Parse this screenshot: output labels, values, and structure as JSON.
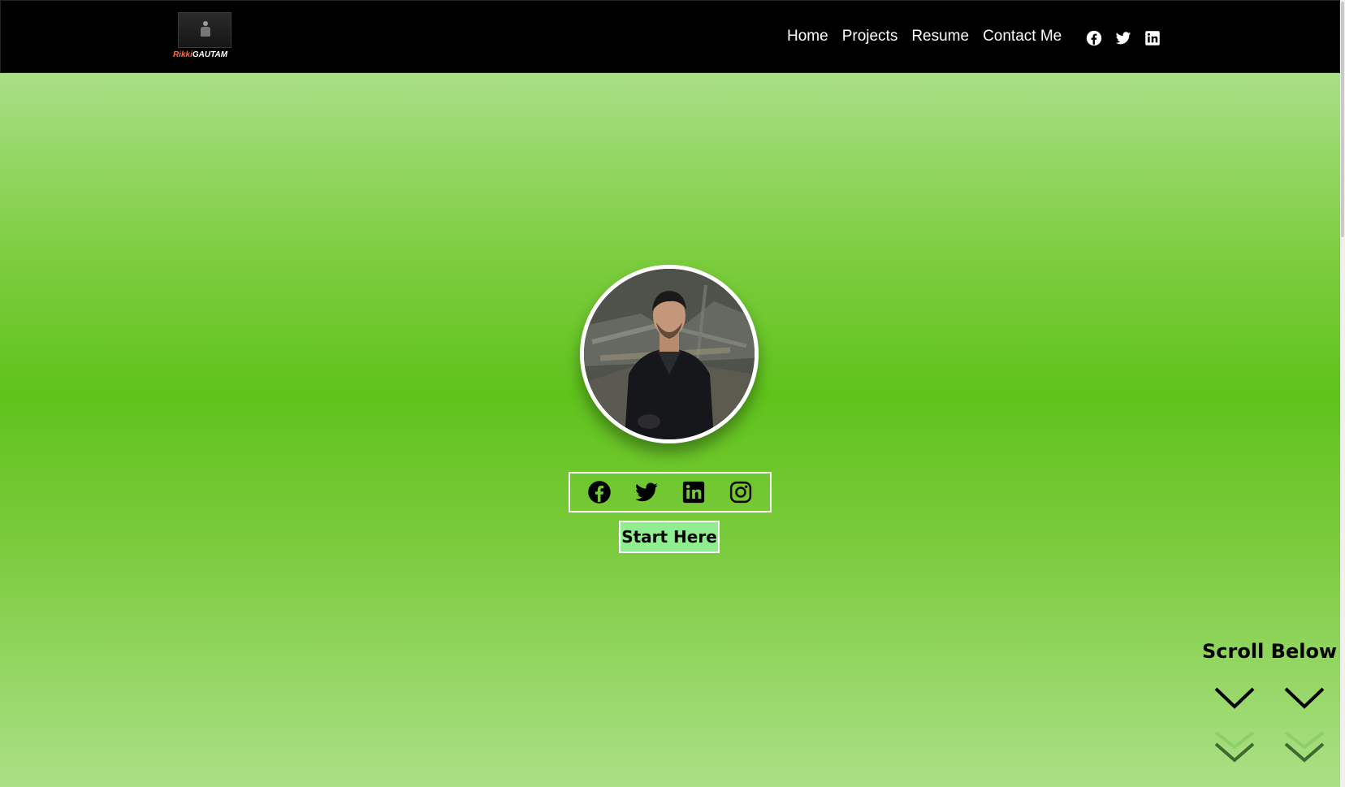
{
  "logo": {
    "first": "Rikki",
    "last": "GAUTAM"
  },
  "nav": {
    "links": [
      {
        "label": "Home"
      },
      {
        "label": "Projects"
      },
      {
        "label": "Resume"
      },
      {
        "label": "Contact Me"
      }
    ],
    "social_icons": [
      "facebook-icon",
      "twitter-icon",
      "linkedin-icon"
    ]
  },
  "hero": {
    "social_icons": [
      "facebook-icon",
      "twitter-icon",
      "linkedin-icon",
      "instagram-icon"
    ],
    "start_button": "Start Here",
    "scroll_label": "Scroll Below"
  },
  "colors": {
    "navbar": "#000000",
    "hero_mid": "#5fc31b",
    "hero_edge": "#a9df86",
    "button_bg": "#90ee90",
    "logo_accent": "#ff6a3d"
  }
}
